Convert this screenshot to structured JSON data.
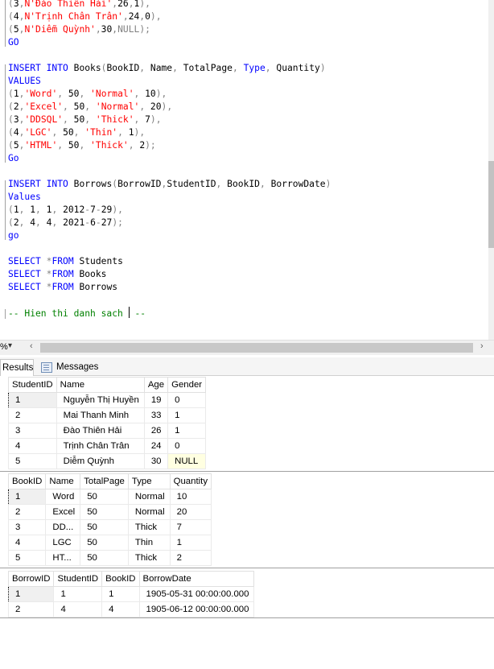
{
  "editor": {
    "lines": [
      [
        [
          "op",
          "("
        ],
        [
          "",
          "3"
        ],
        [
          "op",
          ","
        ],
        [
          "str",
          "N'Đào Thiên Hải'"
        ],
        [
          "op",
          ","
        ],
        [
          "",
          "26"
        ],
        [
          "op",
          ","
        ],
        [
          "",
          "1"
        ],
        [
          "op",
          "),"
        ]
      ],
      [
        [
          "op",
          "("
        ],
        [
          "",
          "4"
        ],
        [
          "op",
          ","
        ],
        [
          "str",
          "N'Trịnh Chân Trân'"
        ],
        [
          "op",
          ","
        ],
        [
          "",
          "24"
        ],
        [
          "op",
          ","
        ],
        [
          "",
          "0"
        ],
        [
          "op",
          "),"
        ]
      ],
      [
        [
          "op",
          "("
        ],
        [
          "",
          "5"
        ],
        [
          "op",
          ","
        ],
        [
          "str",
          "N'Diễm Quỳnh'"
        ],
        [
          "op",
          ","
        ],
        [
          "",
          "30"
        ],
        [
          "op",
          ","
        ],
        [
          "nul",
          "NULL"
        ],
        [
          "op",
          ");"
        ]
      ],
      [
        [
          "kw",
          "GO"
        ]
      ],
      [],
      [
        [
          "kw",
          "INSERT"
        ],
        [
          "",
          " "
        ],
        [
          "kw",
          "INTO"
        ],
        [
          "",
          " Books"
        ],
        [
          "op",
          "("
        ],
        [
          "",
          "BookID"
        ],
        [
          "op",
          ","
        ],
        [
          "",
          " Name"
        ],
        [
          "op",
          ","
        ],
        [
          "",
          " TotalPage"
        ],
        [
          "op",
          ","
        ],
        [
          "",
          " "
        ],
        [
          "kw",
          "Type"
        ],
        [
          "op",
          ","
        ],
        [
          "",
          " Quantity"
        ],
        [
          "op",
          ")"
        ]
      ],
      [
        [
          "kw",
          "VALUES"
        ]
      ],
      [
        [
          "op",
          "("
        ],
        [
          "",
          "1"
        ],
        [
          "op",
          ","
        ],
        [
          "str",
          "'Word'"
        ],
        [
          "op",
          ","
        ],
        [
          "",
          " 50"
        ],
        [
          "op",
          ","
        ],
        [
          "",
          " "
        ],
        [
          "str",
          "'Normal'"
        ],
        [
          "op",
          ","
        ],
        [
          "",
          " 10"
        ],
        [
          "op",
          "),"
        ]
      ],
      [
        [
          "op",
          "("
        ],
        [
          "",
          "2"
        ],
        [
          "op",
          ","
        ],
        [
          "str",
          "'Excel'"
        ],
        [
          "op",
          ","
        ],
        [
          "",
          " 50"
        ],
        [
          "op",
          ","
        ],
        [
          "",
          " "
        ],
        [
          "str",
          "'Normal'"
        ],
        [
          "op",
          ","
        ],
        [
          "",
          " 20"
        ],
        [
          "op",
          "),"
        ]
      ],
      [
        [
          "op",
          "("
        ],
        [
          "",
          "3"
        ],
        [
          "op",
          ","
        ],
        [
          "str",
          "'DDSQL'"
        ],
        [
          "op",
          ","
        ],
        [
          "",
          " 50"
        ],
        [
          "op",
          ","
        ],
        [
          "",
          " "
        ],
        [
          "str",
          "'Thick'"
        ],
        [
          "op",
          ","
        ],
        [
          "",
          " 7"
        ],
        [
          "op",
          "),"
        ]
      ],
      [
        [
          "op",
          "("
        ],
        [
          "",
          "4"
        ],
        [
          "op",
          ","
        ],
        [
          "str",
          "'LGC'"
        ],
        [
          "op",
          ","
        ],
        [
          "",
          " 50"
        ],
        [
          "op",
          ","
        ],
        [
          "",
          " "
        ],
        [
          "str",
          "'Thin'"
        ],
        [
          "op",
          ","
        ],
        [
          "",
          " 1"
        ],
        [
          "op",
          "),"
        ]
      ],
      [
        [
          "op",
          "("
        ],
        [
          "",
          "5"
        ],
        [
          "op",
          ","
        ],
        [
          "str",
          "'HTML'"
        ],
        [
          "op",
          ","
        ],
        [
          "",
          " 50"
        ],
        [
          "op",
          ","
        ],
        [
          "",
          " "
        ],
        [
          "str",
          "'Thick'"
        ],
        [
          "op",
          ","
        ],
        [
          "",
          " 2"
        ],
        [
          "op",
          ");"
        ]
      ],
      [
        [
          "kw",
          "Go"
        ]
      ],
      [],
      [
        [
          "kw",
          "INSERT"
        ],
        [
          "",
          " "
        ],
        [
          "kw",
          "INTO"
        ],
        [
          "",
          " Borrows"
        ],
        [
          "op",
          "("
        ],
        [
          "",
          "BorrowID"
        ],
        [
          "op",
          ","
        ],
        [
          "",
          "StudentID"
        ],
        [
          "op",
          ","
        ],
        [
          "",
          " BookID"
        ],
        [
          "op",
          ","
        ],
        [
          "",
          " BorrowDate"
        ],
        [
          "op",
          ")"
        ]
      ],
      [
        [
          "kw",
          "Values"
        ]
      ],
      [
        [
          "op",
          "("
        ],
        [
          "",
          "1"
        ],
        [
          "op",
          ","
        ],
        [
          "",
          " 1"
        ],
        [
          "op",
          ","
        ],
        [
          "",
          " 1"
        ],
        [
          "op",
          ","
        ],
        [
          "",
          " 2012"
        ],
        [
          "op",
          "-"
        ],
        [
          "",
          "7"
        ],
        [
          "op",
          "-"
        ],
        [
          "",
          "29"
        ],
        [
          "op",
          "),"
        ]
      ],
      [
        [
          "op",
          "("
        ],
        [
          "",
          "2"
        ],
        [
          "op",
          ","
        ],
        [
          "",
          " 4"
        ],
        [
          "op",
          ","
        ],
        [
          "",
          " 4"
        ],
        [
          "op",
          ","
        ],
        [
          "",
          " 2021"
        ],
        [
          "op",
          "-"
        ],
        [
          "",
          "6"
        ],
        [
          "op",
          "-"
        ],
        [
          "",
          "27"
        ],
        [
          "op",
          ");"
        ]
      ],
      [
        [
          "kw",
          "go"
        ]
      ],
      [],
      [
        [
          "kw",
          "SELECT"
        ],
        [
          "",
          " "
        ],
        [
          "op",
          "*"
        ],
        [
          "kw",
          "FROM"
        ],
        [
          "",
          " Students"
        ]
      ],
      [
        [
          "kw",
          "SELECT"
        ],
        [
          "",
          " "
        ],
        [
          "op",
          "*"
        ],
        [
          "kw",
          "FROM"
        ],
        [
          "",
          " Books"
        ]
      ],
      [
        [
          "kw",
          "SELECT"
        ],
        [
          "",
          " "
        ],
        [
          "op",
          "*"
        ],
        [
          "kw",
          "FROM"
        ],
        [
          "",
          " Borrows"
        ]
      ],
      [],
      [
        [
          "cm",
          "-- Hien thi danh sach "
        ],
        [
          "caret",
          ""
        ],
        [
          "cm",
          " --"
        ]
      ]
    ]
  },
  "statusbar": {
    "zoom": "%",
    "zoom_dropdown": "▾",
    "left_arrow": "‹",
    "right_arrow": "›"
  },
  "tabs": {
    "results": "Results",
    "messages": "Messages"
  },
  "grids": [
    {
      "name": "students-grid",
      "columns": [
        "StudentID",
        "Name",
        "Age",
        "Gender"
      ],
      "rows": [
        [
          "1",
          "Nguyễn Thị Huyền",
          "19",
          "0"
        ],
        [
          "2",
          "Mai Thanh Minh",
          "33",
          "1"
        ],
        [
          "3",
          "Đào Thiên Hải",
          "26",
          "1"
        ],
        [
          "4",
          "Trịnh Chân Trân",
          "24",
          "0"
        ],
        [
          "5",
          "Diễm Quỳnh",
          "30",
          "NULL"
        ]
      ]
    },
    {
      "name": "books-grid",
      "columns": [
        "BookID",
        "Name",
        "TotalPage",
        "Type",
        "Quantity"
      ],
      "rows": [
        [
          "1",
          "Word",
          "50",
          "Normal",
          "10"
        ],
        [
          "2",
          "Excel",
          "50",
          "Normal",
          "20"
        ],
        [
          "3",
          "DD...",
          "50",
          "Thick",
          "7"
        ],
        [
          "4",
          "LGC",
          "50",
          "Thin",
          "1"
        ],
        [
          "5",
          "HT...",
          "50",
          "Thick",
          "2"
        ]
      ]
    },
    {
      "name": "borrows-grid",
      "columns": [
        "BorrowID",
        "StudentID",
        "BookID",
        "BorrowDate"
      ],
      "rows": [
        [
          "1",
          "1",
          "1",
          "1905-05-31 00:00:00.000"
        ],
        [
          "2",
          "4",
          "4",
          "1905-06-12 00:00:00.000"
        ]
      ]
    }
  ]
}
